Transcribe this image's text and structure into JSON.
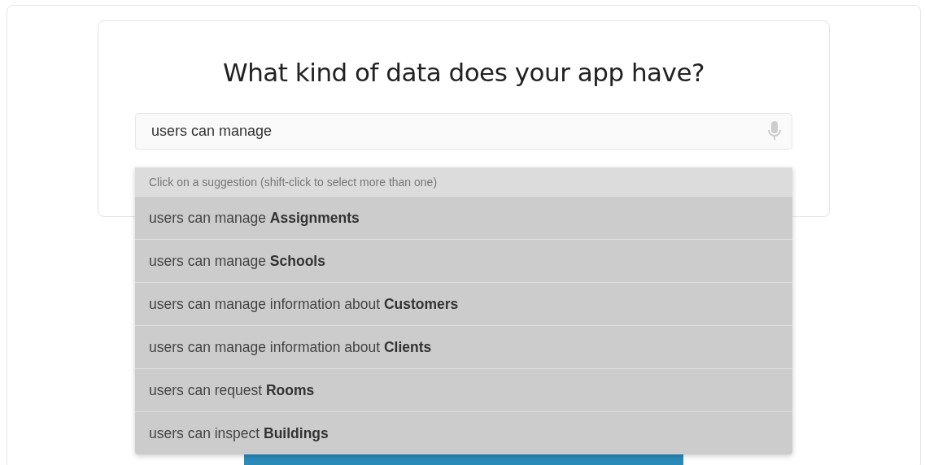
{
  "question": "What kind of data does your app have?",
  "search": {
    "value": "users can manage"
  },
  "suggestions": {
    "hint": "Click on a suggestion (shift-click to select more than one)",
    "items": [
      {
        "text": "users can manage **Assignments**"
      },
      {
        "text": "users can manage **Schools**"
      },
      {
        "text": "users can manage information about **Customers**"
      },
      {
        "text": "users can manage information about **Clients**"
      },
      {
        "text": "users can request **Rooms**"
      },
      {
        "text": "users can inspect **Buildings**"
      }
    ]
  }
}
